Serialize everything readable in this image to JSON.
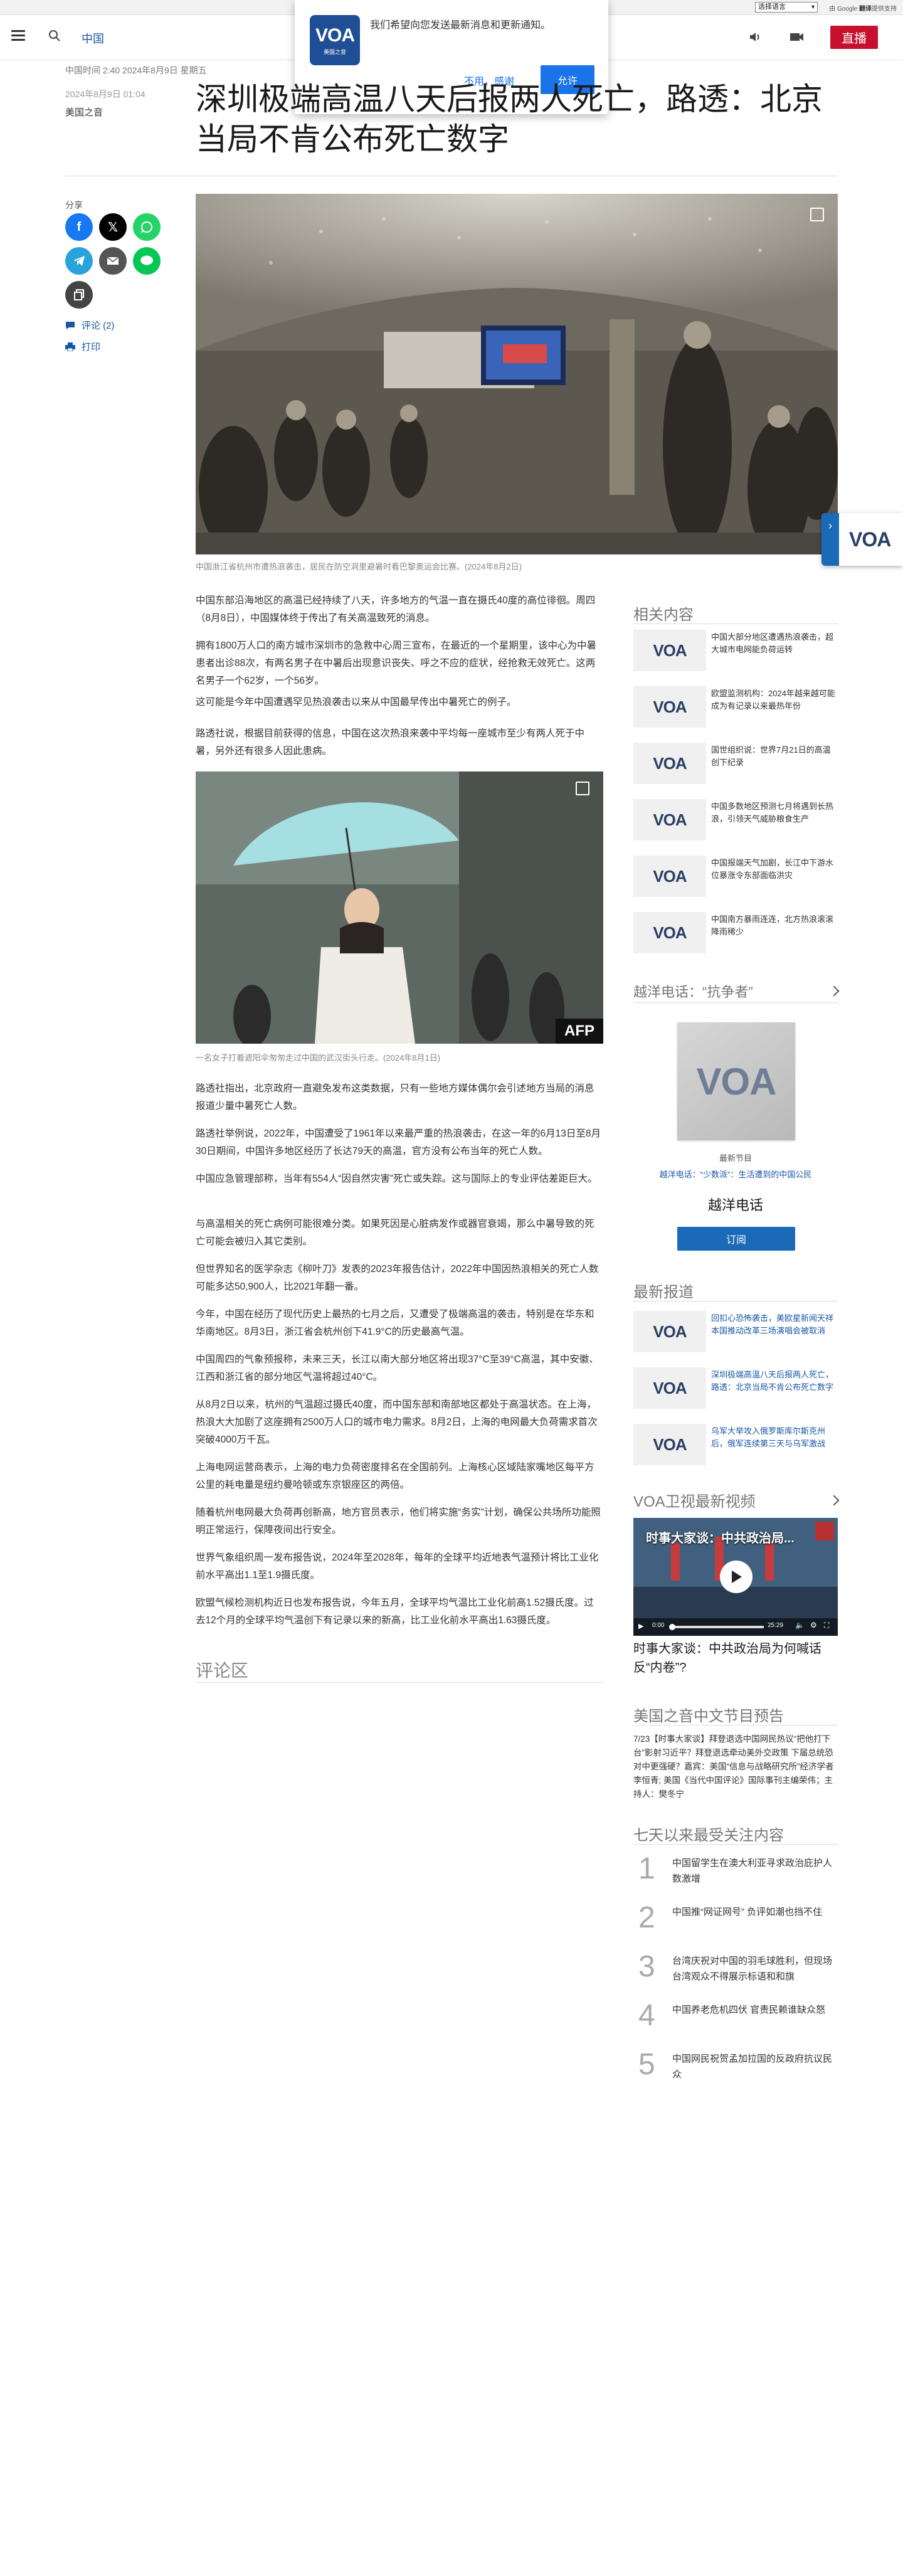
{
  "topbar": {
    "language_select": "选择语言",
    "powered_by": "由 Google",
    "translate": "翻译",
    "translate_suffix": "提供支持"
  },
  "header": {
    "section": "中国",
    "live_label": "直播"
  },
  "notification": {
    "message": "我们希望向您发送最新消息和更新通知。",
    "decline": "不用，感谢",
    "allow": "允许",
    "logo_text": "VOA",
    "logo_sub": "美国之音"
  },
  "article": {
    "meta_time": "中国时间 2:40 2024年8月9日 星期五",
    "date": "2024年8月9日 01:04",
    "author": "美国之音",
    "headline": "深圳极端高温八天后报两人死亡，路透：北京当局不肯公布死亡数字",
    "share_label": "分享",
    "comments_link": "评论 (2)",
    "print_link": "打印",
    "hero_caption": "中国浙江省杭州市遭热浪袭击，居民在防空洞里避暑时看巴黎奥运会比赛。(2024年8月2日)",
    "image2_caption": "一名女子打着遮阳伞匆匆走过中国的武汉街头行走。(2024年8月1日)",
    "afp": "AFP",
    "paragraphs": [
      "中国东部沿海地区的高温已经持续了八天，许多地方的气温一直在摄氏40度的高位徘徊。周四（8月8日），中国媒体终于传出了有关高温致死的消息。",
      "拥有1800万人口的南方城市深圳市的急救中心周三宣布，在最近的一个星期里，该中心为中暑患者出诊88次，有两名男子在中暑后出现意识丧失、呼之不应的症状，经抢救无效死亡。这两名男子一个62岁，一个56岁。",
      "这可能是今年中国遭遇罕见热浪袭击以来从中国最早传出中暑死亡的例子。",
      "路透社说，根据目前获得的信息，中国在这次热浪来袭中平均每一座城市至少有两人死于中暑，另外还有很多人因此患病。",
      "路透社指出，北京政府一直避免发布这类数据，只有一些地方媒体偶尔会引述地方当局的消息报道少量中暑死亡人数。",
      "路透社举例说，2022年，中国遭受了1961年以来最严重的热浪袭击，在这一年的6月13日至8月30日期间，中国许多地区经历了长达79天的高温，官方没有公布当年的死亡人数。",
      "中国应急管理部称，当年有554人“因自然灾害”死亡或失踪。这与国际上的专业评估差距巨大。",
      "与高温相关的死亡病例可能很难分类。如果死因是心脏病发作或器官衰竭，那么中暑导致的死亡可能会被归入其它类别。",
      "但世界知名的医学杂志《柳叶刀》发表的2023年报告估计，2022年中国因热浪相关的死亡人数可能多达50,900人，比2021年翻一番。",
      "今年，中国在经历了现代历史上最热的七月之后，又遭受了极端高温的袭击，特别是在华东和华南地区。8月3日，浙江省会杭州创下41.9°C的历史最高气温。",
      "中国周四的气象预报称，未来三天，长江以南大部分地区将出现37°C至39°C高温，其中安徽、江西和浙江省的部分地区气温将超过40°C。",
      "从8月2日以来，杭州的气温超过摄氏40度，而中国东部和南部地区都处于高温状态。在上海，热浪大大加剧了这座拥有2500万人口的城市电力需求。8月2日，上海的电网最大负荷需求首次突破4000万千瓦。",
      "上海电网运营商表示，上海的电力负荷密度排名在全国前列。上海核心区域陆家嘴地区每平方公里的耗电量是纽约曼哈顿或东京银座区的两倍。",
      "随着杭州电网最大负荷再创新高，地方官员表示，他们将实施“务实”计划，确保公共场所功能照明正常运行，保障夜间出行安全。",
      "世界气象组织周一发布报告说，2024年至2028年，每年的全球平均近地表气温预计将比工业化前水平高出1.1至1.9摄氏度。",
      "欧盟气候检测机构近日也发布报告说，今年五月，全球平均气温比工业化前高1.52摄氏度。过去12个月的全球平均气温创下有记录以来的新高，比工业化前水平高出1.63摄氏度。"
    ],
    "comments_header": "评论区"
  },
  "sidebar": {
    "related_title": "相关内容",
    "related": [
      "中国大部分地区遭遇热浪袭击，超大城市电网能负荷运转",
      "欧盟监测机构：2024年越来越可能成为有记录以来最热年份",
      "国世组织说：世界7月21日的高温创下纪录",
      "中国多数地区预测七月将遇到长热浪，引领天气威胁粮食生产",
      "中国报端天气加剧，长江中下游水位暴涨令东部面临洪灾",
      "中国南方暴雨连连，北方热浪滚滚降雨稀少"
    ],
    "podcast_title": "越洋电话：“抗争者”",
    "podcast_tag": "最新节目",
    "podcast_episode": "越洋电话：“少数派”：生活遭到的中国公民",
    "podcast_name": "越洋电话",
    "subscribe": "订阅",
    "latest_title": "最新报道",
    "latest": [
      "回扣心恐怖袭击，美欧星新闻天祥本国推动改革三场演唱会被取消",
      "深圳极端高温八天后报两人死亡，路透：北京当局不肯公布死亡数字",
      "乌军大举攻入俄罗斯库尔斯克州后，俄军连续第三天与乌军激战"
    ],
    "video_title": "VOA卫视最新视频",
    "video_overlay": "时事大家谈：中共政治局...",
    "video_time_current": "0:00",
    "video_time_total": "25:29",
    "video_caption": "时事大家谈：中共政治局为何喊话反“内卷”?",
    "program_title": "美国之音中文节目预告",
    "program_text": "7/23【时事大家谈】拜登退选中国网民热议“把他打下台”影射习近平？拜登退选牵动美外交政策 下届总统恐对中更强硬？嘉宾：美国“信息与战略研究所”经济学者李恒青; 美国《当代中国评论》国际事刊主编荣伟；主持人：樊冬宁",
    "top_title": "七天以来最受关注内容",
    "top_items": [
      {
        "num": "1",
        "text": "中国留学生在澳大利亚寻求政治庇护人数激增"
      },
      {
        "num": "2",
        "text": "中国推“网证网号” 负评如潮也挡不住"
      },
      {
        "num": "3",
        "text": "台湾庆祝对中国的羽毛球胜利，但现场台湾观众不得展示标语和和旗"
      },
      {
        "num": "4",
        "text": "中国养老危机四伏 官责民赖谁缺众怒"
      },
      {
        "num": "5",
        "text": "中国网民祝贺孟加拉国的反政府抗议民众"
      }
    ]
  },
  "colors": {
    "live": "#c8102e",
    "link": "#1a56a8",
    "allow": "#1a73e8",
    "subscribe": "#1a6ab8"
  },
  "icons": [
    "hamburger-icon",
    "search-icon",
    "volume-icon",
    "video-icon",
    "expand-icon",
    "facebook-icon",
    "x-icon",
    "whatsapp-icon",
    "telegram-icon",
    "email-icon",
    "line-icon",
    "copy-link-icon",
    "comment-icon",
    "print-icon",
    "play-icon",
    "chevron-right-icon",
    "arrow-right-icon"
  ]
}
